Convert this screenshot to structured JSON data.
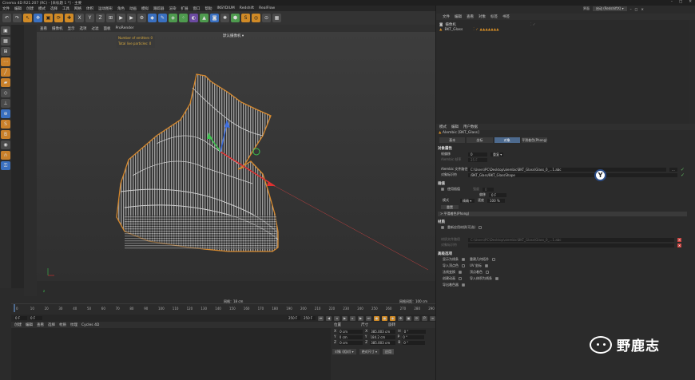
{
  "window": {
    "title": "Cinema 4D R21.207 (RC) - [未标题 1 *] - 主要"
  },
  "menubar": {
    "items": [
      "文件",
      "编辑",
      "创建",
      "模式",
      "选择",
      "工具",
      "网格",
      "体积",
      "运动图形",
      "角色",
      "动画",
      "模拟",
      "跟踪器",
      "渲染",
      "扩展",
      "窗口",
      "帮助",
      "INSYDIUM",
      "Redshift",
      "RealFlow"
    ]
  },
  "toolbar": {
    "icons": [
      "undo-icon",
      "redo-icon",
      "live-select-icon",
      "move-icon",
      "scale-icon",
      "rotate-icon",
      "add-icon",
      "x-axis-icon",
      "y-axis-icon",
      "z-axis-icon",
      "coordinate-icon",
      "render-view-icon",
      "render-icon",
      "render-settings-icon",
      "cube-icon",
      "pen-icon",
      "subdivide-icon",
      "array-icon",
      "deformer-icon",
      "scene-icon",
      "camera-icon",
      "light-icon"
    ]
  },
  "viewport": {
    "menu": [
      "查看",
      "摄像机",
      "显示",
      "选项",
      "过滤",
      "面板",
      "ProRender"
    ],
    "camera": "默认摄像机",
    "info": [
      "Number of emitters 0",
      "Total live particles: 0"
    ],
    "grid_label": "网格：18 cm",
    "grid_spacing": "网格间距：100 cm",
    "axis": "z"
  },
  "timeline": {
    "ticks": [
      "0",
      "10",
      "20",
      "30",
      "40",
      "50",
      "60",
      "70",
      "80",
      "90",
      "100",
      "110",
      "120",
      "130",
      "140",
      "150",
      "160",
      "170",
      "180",
      "190",
      "200",
      "210",
      "220",
      "230",
      "240",
      "250",
      "260",
      "270",
      "280",
      "290"
    ],
    "current": "0 F",
    "start": "0 F",
    "end": "250 F",
    "end2": "250 F"
  },
  "material": {
    "menu": [
      "创建",
      "编辑",
      "查看",
      "选择",
      "材质",
      "纹理",
      "Cycles 4D"
    ]
  },
  "coords": {
    "headers": [
      "位置",
      "尺寸",
      "旋转"
    ],
    "rows": [
      {
        "a": "X",
        "pos": "0 cm",
        "size": "385.003 cm",
        "rot": "H",
        "rval": "0 °"
      },
      {
        "a": "Y",
        "pos": "0 cm",
        "size": "184.2 cm",
        "rot": "P",
        "rval": "0 °"
      },
      {
        "a": "Z",
        "pos": "0 cm",
        "size": "385.003 cm",
        "rot": "B",
        "rval": "0 °"
      }
    ],
    "mode": "对象 (相对)",
    "size_mode": "绝对尺寸",
    "apply": "应用"
  },
  "objects": {
    "menu": [
      "文件",
      "编辑",
      "查看",
      "对象",
      "标签",
      "书签"
    ],
    "layout_label": "界面",
    "layout": "启动 (RedshiftX)",
    "rows": [
      {
        "name": "摄像机",
        "indent": 0
      },
      {
        "name": "BKT_Glass",
        "indent": 0
      }
    ]
  },
  "attributes": {
    "menu": [
      "模式",
      "编辑",
      "用户数据"
    ],
    "object_name": "Alembic [BKT_Glass]",
    "tabs": [
      "基本",
      "坐标",
      "对象",
      "平滑着色(Phong)"
    ],
    "active_tab": "对象",
    "section1": "对象属性",
    "frame_label": "帧偏移",
    "frame_value": "0",
    "frame_unit": "重复",
    "fps_label": "Alembic 帧率",
    "fps_value": "25 F",
    "file_label": "Alembic 文件路径",
    "file_value": "C:\\Users\\PC\\Desktop\\alembic\\BKT_Glass\\Glass_0_...1.abc",
    "identifier_label": "对象标识符",
    "identifier_value": "/BKT_Glass/BKT_GlassShape",
    "section2": "插值",
    "interp_label": "使用插值",
    "smooth_label": "强度",
    "smooth_value": "0",
    "blend_label": "偏移",
    "blend_value": "0 F",
    "mode_label": "模式",
    "mode_value": "精确",
    "speed_label": "速度",
    "speed_value": "100 %",
    "reset": "重置",
    "section3": "> 平滑着色(Phong)",
    "section4": "材质",
    "mat_check": "重新应用材质(可选)",
    "mat_path_label": "材质文件路径",
    "mat_path_value": "C:\\Users\\PC\\Desktop\\alembic\\BKT_Glass\\Glass_0_...1.abc",
    "mat_id_label": "对象标识符",
    "section5": "高级选项",
    "options": [
      [
        "显示为线条",
        "重建几何拓扑"
      ],
      [
        "导入顶点色",
        "UV 坐标"
      ],
      [
        "法线变换",
        "顶点着色"
      ],
      [
        "创建动画",
        "导入体积为线条"
      ],
      [
        "导出着色器",
        ""
      ]
    ]
  },
  "watermark": {
    "text": "野鹿志"
  },
  "colors": {
    "accent": "#d08a26",
    "selection": "#4d6a8e",
    "mesh_outline": "#d88a2e",
    "axis_x": "#e03030",
    "axis_y": "#3ec24f",
    "axis_z": "#3f6fe0"
  }
}
